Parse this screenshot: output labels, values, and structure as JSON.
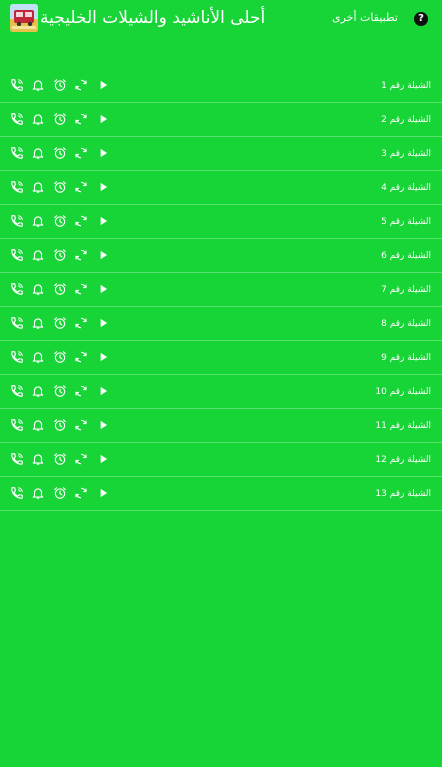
{
  "app": {
    "title": "أحلى الأناشيد والشيلات الخليجية",
    "other_apps_label": "تطبيقات أخرى",
    "help_label": "?"
  },
  "icons": {
    "ringtone": "phone-ring-icon",
    "notification": "bell-icon",
    "alarm": "alarm-clock-icon",
    "loop": "repeat-icon",
    "play": "play-icon"
  },
  "colors": {
    "background": "#17d437",
    "foreground": "#ffffff"
  },
  "tracks": [
    {
      "label": "الشيلة رقم 1"
    },
    {
      "label": "الشيلة رقم 2"
    },
    {
      "label": "الشيلة رقم 3"
    },
    {
      "label": "الشيلة رقم 4"
    },
    {
      "label": "الشيلة رقم 5"
    },
    {
      "label": "الشيلة رقم 6"
    },
    {
      "label": "الشيلة رقم 7"
    },
    {
      "label": "الشيلة رقم 8"
    },
    {
      "label": "الشيلة رقم 9"
    },
    {
      "label": "الشيلة رقم 10"
    },
    {
      "label": "الشيلة رقم 11"
    },
    {
      "label": "الشيلة رقم 12"
    },
    {
      "label": "الشيلة رقم 13"
    }
  ]
}
